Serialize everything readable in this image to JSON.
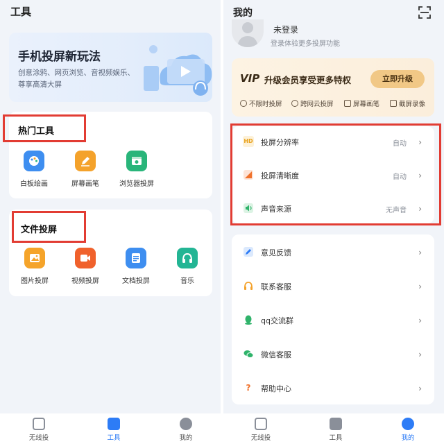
{
  "left": {
    "title": "工具",
    "banner": {
      "title": "手机投屏新玩法",
      "subtitle": "创意涂鸦、网页浏览、音视频娱乐、尊享高清大屏"
    },
    "hot_tools": {
      "title": "热门工具",
      "items": [
        {
          "label": "白板绘画",
          "icon": "palette-icon",
          "color": "#3e8ef0"
        },
        {
          "label": "屏幕画笔",
          "icon": "pen-icon",
          "color": "#f4a22b"
        },
        {
          "label": "浏览器投屏",
          "icon": "browser-icon",
          "color": "#29b57a"
        }
      ]
    },
    "file_cast": {
      "title": "文件投屏",
      "items": [
        {
          "label": "图片投屏",
          "icon": "image-icon",
          "color": "#f5a42a"
        },
        {
          "label": "视频投屏",
          "icon": "video-icon",
          "color": "#f0612c"
        },
        {
          "label": "文档投屏",
          "icon": "document-icon",
          "color": "#3e8ef0"
        },
        {
          "label": "音乐",
          "icon": "headphones-icon",
          "color": "#23b594"
        }
      ]
    },
    "tabs": [
      {
        "label": "无线投",
        "icon": "wireless-icon",
        "active": false
      },
      {
        "label": "工具",
        "icon": "toolbox-icon",
        "active": true
      },
      {
        "label": "我的",
        "icon": "profile-icon",
        "active": false
      }
    ]
  },
  "right": {
    "title": "我的",
    "user": {
      "name": "未登录",
      "subtitle": "登录体验更多投屏功能"
    },
    "vip": {
      "logo": "VIP",
      "text": "升级会员享受更多特权",
      "button": "立即升级",
      "features": [
        "不限时投屏",
        "跨网云投屏",
        "屏幕画笔",
        "截屏录像"
      ]
    },
    "settings": [
      {
        "label": "投屏分辨率",
        "value": "自动",
        "icon": "hd-icon",
        "badge": "HD"
      },
      {
        "label": "投屏清晰度",
        "value": "自动",
        "icon": "clarity-icon"
      },
      {
        "label": "声音来源",
        "value": "无声音",
        "icon": "speaker-icon"
      }
    ],
    "menu": [
      {
        "label": "意见反馈",
        "icon": "feedback-icon"
      },
      {
        "label": "联系客服",
        "icon": "headset-icon"
      },
      {
        "label": "qq交流群",
        "icon": "qq-icon"
      },
      {
        "label": "微信客服",
        "icon": "wechat-icon"
      },
      {
        "label": "帮助中心",
        "icon": "help-icon"
      }
    ],
    "tabs": [
      {
        "label": "无线投",
        "icon": "wireless-icon",
        "active": false
      },
      {
        "label": "工具",
        "icon": "toolbox-icon",
        "active": false
      },
      {
        "label": "我的",
        "icon": "profile-icon",
        "active": true
      }
    ]
  },
  "colors": {
    "accent": "#2d7cf6",
    "highlight": "#e23c33",
    "vip_button": "#f1c886"
  }
}
